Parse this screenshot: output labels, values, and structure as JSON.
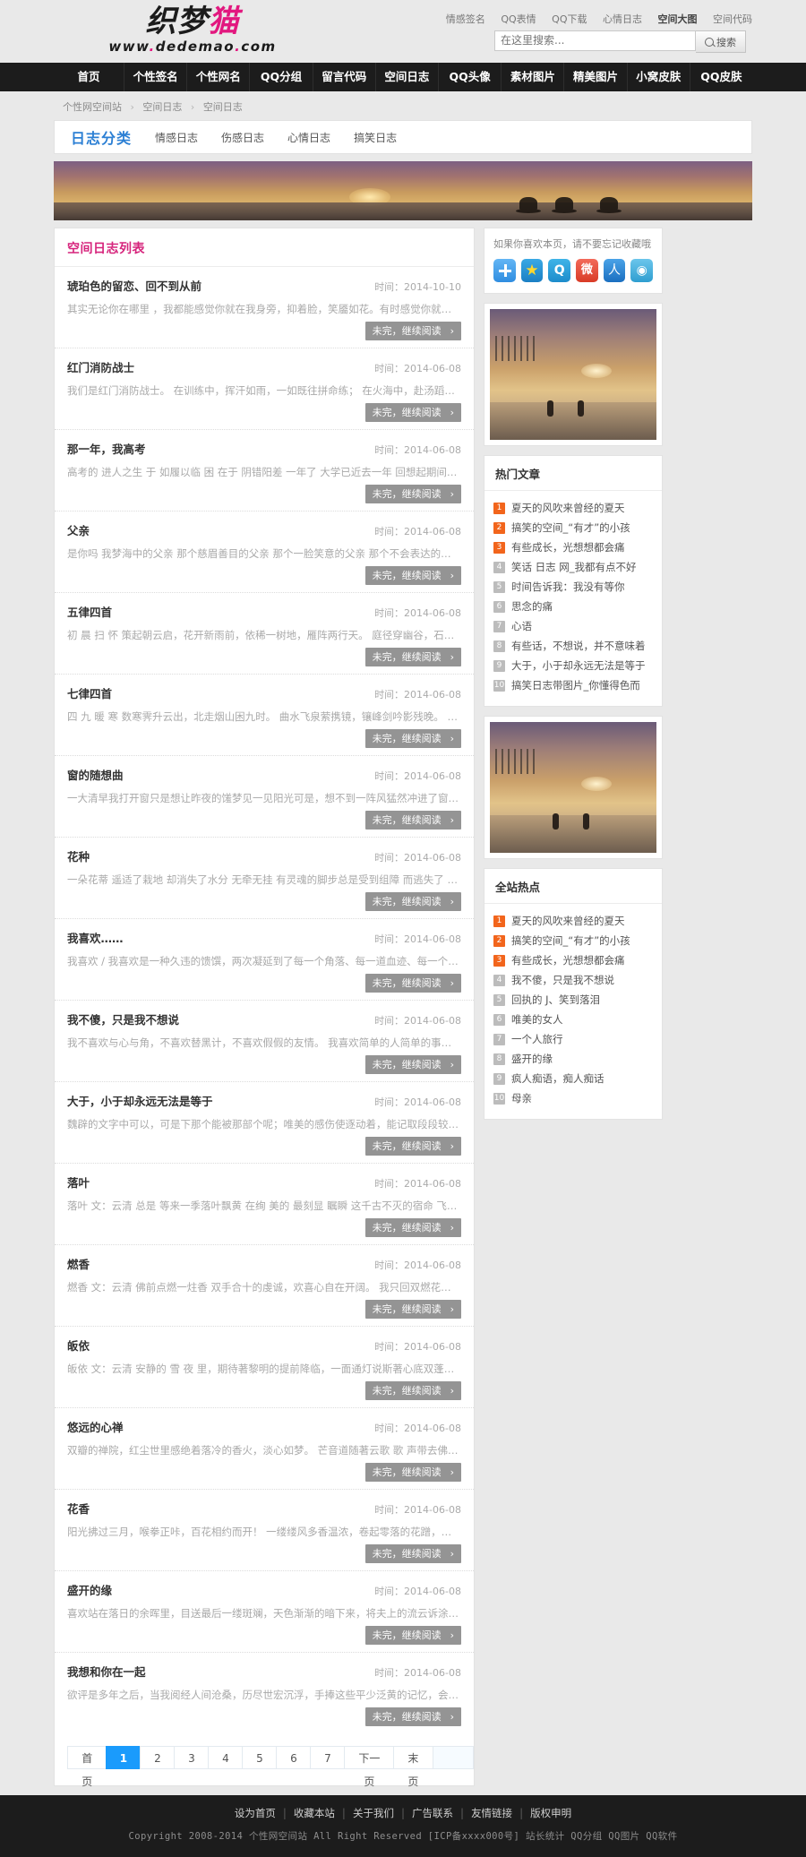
{
  "header": {
    "logo_main_black": "织梦",
    "logo_main_pink": "猫",
    "logo_sub_a": "www",
    "logo_sub_dot1": ".",
    "logo_sub_b": "dedemao",
    "logo_sub_dot2": ".",
    "logo_sub_c": "com",
    "top_links": [
      {
        "label": "情感签名",
        "strong": false
      },
      {
        "label": "QQ表情",
        "strong": false
      },
      {
        "label": "QQ下载",
        "strong": false
      },
      {
        "label": "心情日志",
        "strong": false
      },
      {
        "label": "空间大图",
        "strong": true
      },
      {
        "label": "空间代码",
        "strong": false
      }
    ],
    "search": {
      "placeholder": "在这里搜索...",
      "value": "",
      "button_label": "搜索"
    }
  },
  "nav": {
    "items": [
      "首页",
      "个性签名",
      "个性网名",
      "QQ分组",
      "留言代码",
      "空间日志",
      "QQ头像",
      "素材图片",
      "精美图片",
      "小窝皮肤",
      "QQ皮肤"
    ]
  },
  "breadcrumb": {
    "items": [
      "个性网空间站",
      "空间日志",
      "空间日志"
    ],
    "separator": "›"
  },
  "category_bar": {
    "title": "日志分类",
    "items": [
      "情感日志",
      "伤感日志",
      "心情日志",
      "搞笑日志"
    ]
  },
  "list_panel": {
    "title": "空间日志列表",
    "date_prefix": "时间：",
    "more_label": "未完，继续阅读",
    "more_arrow": "›",
    "posts": [
      {
        "title": "琥珀色的留恋、回不到从前",
        "date": "2014-10-10",
        "desc": "其实无论你在哪里 ，我都能感觉你就在我身旁，抑着脸，笑靥如花。有时感觉你就在我身边，却有迟迟见不到你…"
      },
      {
        "title": "红门消防战士",
        "date": "2014-06-08",
        "desc": "我们是红门消防战士。 在训练中，挥汗如雨，一如既往拼命练； 在火海中，赴汤蹈火，冲锋在前浑不怕。 我们…"
      },
      {
        "title": "那一年，我高考",
        "date": "2014-06-08",
        "desc": "高考的 进人之生 于 如履以临 困 在于 阴错阳差 一年了 大学已近去一年 回想起期间的日子 真的 充实而美…"
      },
      {
        "title": "父亲",
        "date": "2014-06-08",
        "desc": "是你吗 我梦海中的父亲 那个慈眉善目的父亲 那个一脸笑意的父亲 那个不会表达的父亲 曾经 我抱你的付出 现…"
      },
      {
        "title": "五律四首",
        "date": "2014-06-08",
        "desc": "初 晨 扫 怀 策起朝云启，花开新雨前，依稀一树地，雁阵两行天。 庭径穿幽谷，石阶参翠泉。 流年如是水，…"
      },
      {
        "title": "七律四首",
        "date": "2014-06-08",
        "desc": "四 九 暖 寒 数寒霁升云出，北走烟山困九时。 曲水飞泉萦携镜，镶峰剑吟影残晚。 松高雪顶看来早，临波问…"
      },
      {
        "title": "窗的随想曲",
        "date": "2014-06-08",
        "desc": "一大清早我打开窗只是想让昨夜的馐梦见一见阳光可是，想不到一阵风猛然冲进了窗（文章阅读网：www.sanwen.n…"
      },
      {
        "title": "花种",
        "date": "2014-06-08",
        "desc": "一朵花蒂 遥适了栽地 却消失了水分 无牵无挂 有灵魂的脚步总是受到组障 而逃失了 是我的根 我在黑暗里这…"
      },
      {
        "title": "我喜欢……",
        "date": "2014-06-08",
        "desc": "我喜欢 / 我喜欢是一种久违的馈馔，两次凝延到了每一个角落、每一道血迹、每一个毛孔细胞 逐现周身满满的…"
      },
      {
        "title": "我不傻，只是我不想说",
        "date": "2014-06-08",
        "desc": "我不喜欢与心与角，不喜欢替黑计，不喜欢假假的友情。 我喜欢简单的人简单的事，傻傻的，每天喵喵哈哈过！…"
      },
      {
        "title": "大于，小于却永远无法是等于",
        "date": "2014-06-08",
        "desc": "魏辟的文字中可以，可是下那个能被那部个呢；唯美的感伤使逐动着，能记取段段较优那置；有能溃乱的思维去事…"
      },
      {
        "title": "落叶",
        "date": "2014-06-08",
        "desc": "落叶 文：云清 总是 等来一季落叶飘黄 在绚 美的 最刻显 瞩瞬 这千古不灭的宿命 飞扬 零落地 进尽尘尘的…"
      },
      {
        "title": "燃香",
        "date": "2014-06-08",
        "desc": "燃香 文：云清 佛前点燃一炷香 双手合十的虔诚，欢喜心自在开阔。 我只回双燃花自，学佛喝圣（散文 网）ww…"
      },
      {
        "title": "皈依",
        "date": "2014-06-08",
        "desc": "皈依 文：云清 安静的 雪 夜 里，期待著黎明的提前降临，一面通灯说斯著心底双蓬胶千登与殇馆，忙立村（…"
      },
      {
        "title": "悠远的心禅",
        "date": "2014-06-08",
        "desc": "双瓣的禅院，红尘世里感绝着落冷的香火，淡心如梦。 芒音道随著云歌 歌 声带去佛的招随，遥远 八方四千众…"
      },
      {
        "title": "花香",
        "date": "2014-06-08",
        "desc": "阳光拂过三月，喉拳正咔，百花相约而开！ 一缕缕风多香温浓，卷起零落的花蹭，你嗅着花香，飞舞着，飞舞…"
      },
      {
        "title": "盛开的缘",
        "date": "2014-06-08",
        "desc": "喜欢站在落日的余晖里，目送最后一缕斑斓，天色渐渐的暗下来，将夫上的流云诉涂蓬染，我等诗星空相望，…"
      },
      {
        "title": "我想和你在一起",
        "date": "2014-06-08",
        "desc": "欲评是多年之后，当我阅经人间沧桑，历尽世宏沉浮，手捧这些平少泛黄的记忆，会不会迎泓满面？…"
      }
    ]
  },
  "pagination": {
    "items": [
      {
        "label": "首页",
        "active": false,
        "blank": false
      },
      {
        "label": "1",
        "active": true,
        "blank": false
      },
      {
        "label": "2",
        "active": false,
        "blank": false
      },
      {
        "label": "3",
        "active": false,
        "blank": false
      },
      {
        "label": "4",
        "active": false,
        "blank": false
      },
      {
        "label": "5",
        "active": false,
        "blank": false
      },
      {
        "label": "6",
        "active": false,
        "blank": false
      },
      {
        "label": "7",
        "active": false,
        "blank": false
      },
      {
        "label": "下一页",
        "active": false,
        "blank": false
      },
      {
        "label": "末页",
        "active": false,
        "blank": false
      },
      {
        "label": "",
        "active": false,
        "blank": true
      }
    ]
  },
  "sidebar": {
    "favorite_tip": "如果你喜欢本页，请不要忘记收藏哦",
    "share_icons": [
      {
        "name": "share-plus-icon",
        "glyph": ""
      },
      {
        "name": "share-favorite-star-icon",
        "glyph": "★"
      },
      {
        "name": "share-qzone-icon",
        "glyph": "Q"
      },
      {
        "name": "share-weibo-icon",
        "glyph": "微"
      },
      {
        "name": "share-renren-icon",
        "glyph": "人"
      },
      {
        "name": "share-more-icon",
        "glyph": "◉"
      }
    ],
    "hot_articles": {
      "title": "热门文章",
      "items": [
        "夏天的风吹来曾经的夏天",
        "搞笑的空间_“有才”的小孩",
        "有些成长，光想想都会痛",
        "笑话 日志 网_我都有点不好",
        "时间告诉我：我没有等你",
        "思念的痛",
        "心语",
        "有些话，不想说，并不意味着",
        "大于，小于却永远无法是等于",
        "搞笑日志带图片_你懂得色而"
      ]
    },
    "site_hot": {
      "title": "全站热点",
      "items": [
        "夏天的风吹来曾经的夏天",
        "搞笑的空间_“有才”的小孩",
        "有些成长，光想想都会痛",
        "我不傻，只是我不想说",
        "回执的 J、笑到落泪",
        "唯美的女人",
        "一个人旅行",
        "盛开的缘",
        "疯人痴语，痴人痴话",
        "母亲"
      ]
    }
  },
  "footer": {
    "links": [
      "设为首页",
      "收藏本站",
      "关于我们",
      "广告联系",
      "友情链接",
      "版权申明"
    ],
    "separator": "|",
    "copyright": "Copyright 2008-2014 个性网空间站 All Right Reserved [ICP备xxxx000号] 站长统计 QQ分组 QQ图片 QQ软件"
  }
}
